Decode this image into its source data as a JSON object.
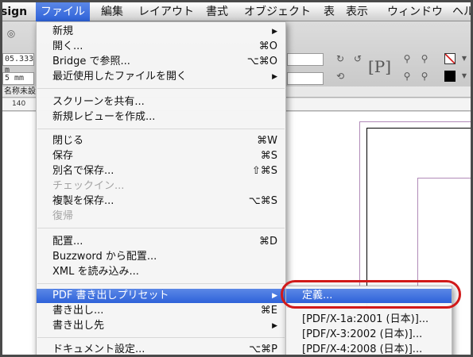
{
  "menubar": {
    "app": "sign",
    "items": [
      "ファイル",
      "編集",
      "レイアウト",
      "書式",
      "オブジェクト",
      "表",
      "表示",
      "ウィンドウ",
      "ヘル"
    ]
  },
  "controlbar": {
    "field_x": "05.333 m",
    "field_y": "5 mm",
    "tab_label": "名称未設",
    "ruler_140": "140"
  },
  "file_menu": {
    "new": "新規",
    "open": "開く...",
    "open_sc": "⌘O",
    "bridge": "Bridge で参照...",
    "bridge_sc": "⌥⌘O",
    "recent": "最近使用したファイルを開く",
    "share_screen": "スクリーンを共有...",
    "new_review": "新規レビューを作成...",
    "close": "閉じる",
    "close_sc": "⌘W",
    "save": "保存",
    "save_sc": "⌘S",
    "save_as": "別名で保存...",
    "save_as_sc": "⇧⌘S",
    "check_in": "チェックイン...",
    "save_copy": "複製を保存...",
    "save_copy_sc": "⌥⌘S",
    "revert": "復帰",
    "place": "配置...",
    "place_sc": "⌘D",
    "place_buzzword": "Buzzword から配置...",
    "import_xml": "XML を読み込み...",
    "pdf_presets": "PDF 書き出しプリセット",
    "export": "書き出し...",
    "export_sc": "⌘E",
    "export_to": "書き出し先",
    "doc_setup": "ドキュメント設定...",
    "doc_setup_sc": "⌥⌘P",
    "submenu_arrow": "▶"
  },
  "submenu": {
    "define": "定義...",
    "x1a": "[PDF/X-1a:2001 (日本)]...",
    "x3": "[PDF/X-3:2002 (日本)]...",
    "x4": "[PDF/X-4:2008 (日本)]..."
  },
  "colors": {
    "highlight": "#3a6de0",
    "callout": "#d11a1a"
  }
}
